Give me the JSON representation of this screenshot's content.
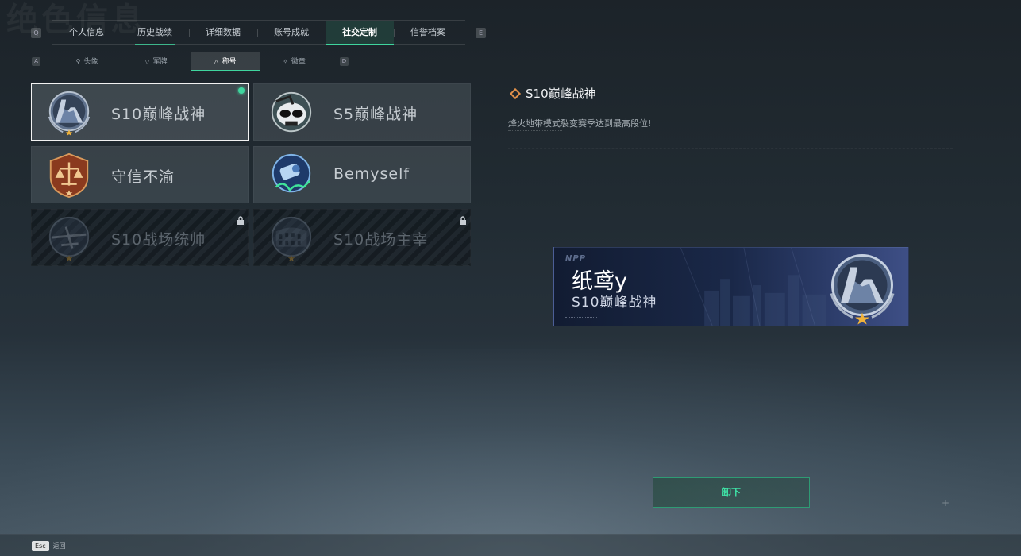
{
  "background": {
    "watermark": "绝色信息"
  },
  "top_nav": {
    "left_key": "Q",
    "right_key": "E",
    "tabs": [
      {
        "label": "个人信息",
        "width": 86
      },
      {
        "label": "历史战绩",
        "width": 86
      },
      {
        "label": "详细数据",
        "width": 86
      },
      {
        "label": "账号成就",
        "width": 86
      },
      {
        "label": "社交定制",
        "width": 86
      },
      {
        "label": "信誉档案",
        "width": 86
      }
    ],
    "active_index": 4
  },
  "sub_nav": {
    "left_key": "A",
    "right_key": "D",
    "tabs": [
      {
        "label": "头像",
        "icon": "person-icon",
        "glyph": "⚲"
      },
      {
        "label": "军牌",
        "icon": "dogtag-icon",
        "glyph": "▽"
      },
      {
        "label": "称号",
        "icon": "title-icon",
        "glyph": "△"
      },
      {
        "label": "徽章",
        "icon": "badge-icon",
        "glyph": "✧"
      }
    ],
    "active_index": 2
  },
  "titles": [
    {
      "label": "S10巅峰战神",
      "emblem": "peak-god-emblem",
      "selected": true,
      "equipped": true,
      "locked": false
    },
    {
      "label": "S5巅峰战神",
      "emblem": "skull-helmet-emblem",
      "selected": false,
      "equipped": false,
      "locked": false
    },
    {
      "label": "守信不渝",
      "emblem": "scales-emblem",
      "selected": false,
      "equipped": false,
      "locked": false
    },
    {
      "label": "Bemyself",
      "emblem": "mascot-emblem",
      "selected": false,
      "equipped": false,
      "locked": false
    },
    {
      "label": "S10战场统帅",
      "emblem": "aircraft-emblem",
      "selected": false,
      "equipped": false,
      "locked": true
    },
    {
      "label": "S10战场主宰",
      "emblem": "colosseum-emblem",
      "selected": false,
      "equipped": false,
      "locked": true
    }
  ],
  "detail": {
    "title": "S10巅峰战神",
    "description": "烽火地带模式裂变赛季达到最高段位!"
  },
  "banner": {
    "logo": "NPP",
    "player_name": "纸鸢y",
    "title": "S10巅峰战神"
  },
  "actions": {
    "unequip_label": "卸下"
  },
  "footer": {
    "esc_key": "Esc",
    "back_label": "返回"
  },
  "colors": {
    "accent": "#3fd59e",
    "detail_diamond": "#e0904a",
    "banner_bg": "#1a2848"
  }
}
